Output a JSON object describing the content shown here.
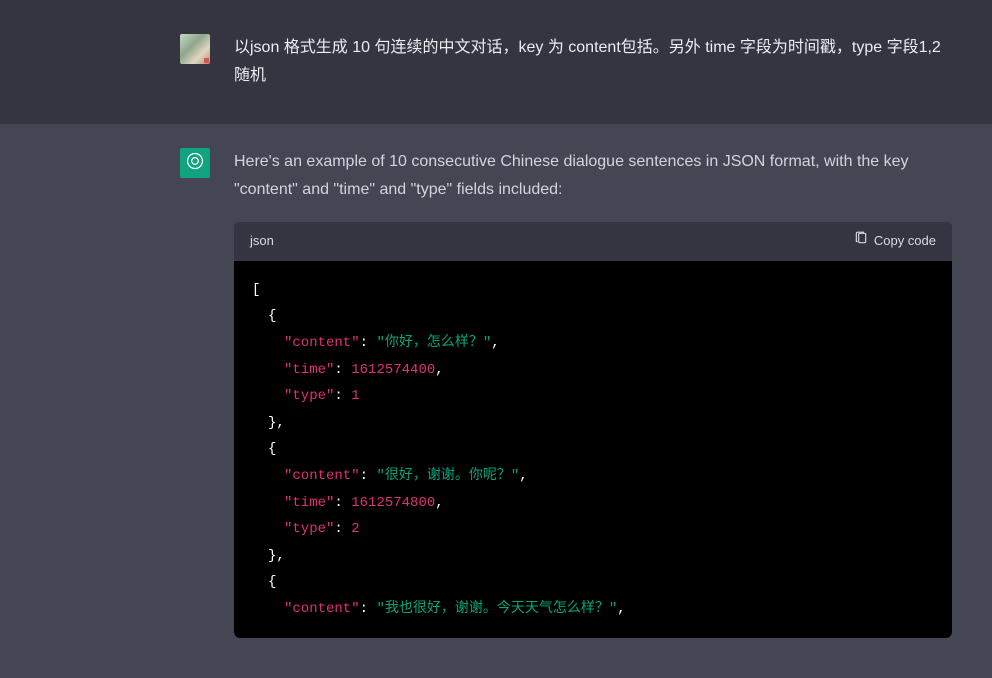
{
  "user": {
    "prompt": "以json 格式生成 10 句连续的中文对话，key 为 content包括。另外 time 字段为时间戳，type 字段1,2 随机"
  },
  "assistant": {
    "intro": "Here's an example of 10 consecutive Chinese dialogue sentences in JSON format, with the key \"content\" and \"time\" and \"type\" fields included:",
    "code_lang": "json",
    "copy_label": "Copy code",
    "code": {
      "lines": [
        {
          "indent": 1,
          "tokens": [
            {
              "t": "punc",
              "v": "["
            }
          ]
        },
        {
          "indent": 2,
          "tokens": [
            {
              "t": "punc",
              "v": "{"
            }
          ]
        },
        {
          "indent": 3,
          "tokens": [
            {
              "t": "key",
              "v": "\"content\""
            },
            {
              "t": "punc",
              "v": ": "
            },
            {
              "t": "str",
              "v": "\"你好，怎么样？\""
            },
            {
              "t": "punc",
              "v": ","
            }
          ]
        },
        {
          "indent": 3,
          "tokens": [
            {
              "t": "key",
              "v": "\"time\""
            },
            {
              "t": "punc",
              "v": ": "
            },
            {
              "t": "num",
              "v": "1612574400"
            },
            {
              "t": "punc",
              "v": ","
            }
          ]
        },
        {
          "indent": 3,
          "tokens": [
            {
              "t": "key",
              "v": "\"type\""
            },
            {
              "t": "punc",
              "v": ": "
            },
            {
              "t": "num",
              "v": "1"
            }
          ]
        },
        {
          "indent": 2,
          "tokens": [
            {
              "t": "punc",
              "v": "},"
            }
          ]
        },
        {
          "indent": 2,
          "tokens": [
            {
              "t": "punc",
              "v": "{"
            }
          ]
        },
        {
          "indent": 3,
          "tokens": [
            {
              "t": "key",
              "v": "\"content\""
            },
            {
              "t": "punc",
              "v": ": "
            },
            {
              "t": "str",
              "v": "\"很好，谢谢。你呢？\""
            },
            {
              "t": "punc",
              "v": ","
            }
          ]
        },
        {
          "indent": 3,
          "tokens": [
            {
              "t": "key",
              "v": "\"time\""
            },
            {
              "t": "punc",
              "v": ": "
            },
            {
              "t": "num",
              "v": "1612574800"
            },
            {
              "t": "punc",
              "v": ","
            }
          ]
        },
        {
          "indent": 3,
          "tokens": [
            {
              "t": "key",
              "v": "\"type\""
            },
            {
              "t": "punc",
              "v": ": "
            },
            {
              "t": "num",
              "v": "2"
            }
          ]
        },
        {
          "indent": 2,
          "tokens": [
            {
              "t": "punc",
              "v": "},"
            }
          ]
        },
        {
          "indent": 2,
          "tokens": [
            {
              "t": "punc",
              "v": "{"
            }
          ]
        },
        {
          "indent": 3,
          "tokens": [
            {
              "t": "key",
              "v": "\"content\""
            },
            {
              "t": "punc",
              "v": ": "
            },
            {
              "t": "str",
              "v": "\"我也很好，谢谢。今天天气怎么样？\""
            },
            {
              "t": "punc",
              "v": ","
            }
          ]
        }
      ]
    }
  }
}
